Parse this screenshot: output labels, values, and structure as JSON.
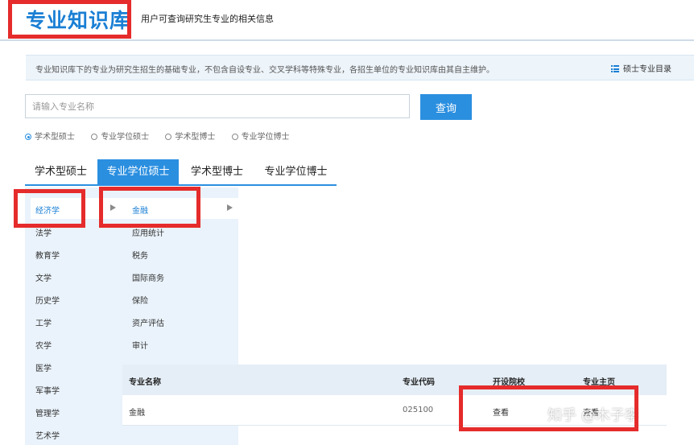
{
  "header": {
    "title": "专业知识库",
    "subtitle": "用户可查询研究生专业的相关信息"
  },
  "notice": {
    "text": "专业知识库下的专业为研究生招生的基础专业，不包含自设专业、交叉学科等特殊专业，各招生单位的专业知识库由其自主维护。",
    "catalog_link": "硕士专业目录"
  },
  "search": {
    "placeholder": "请输入专业名称",
    "value": "",
    "button": "查询"
  },
  "radios": [
    {
      "label": "学术型硕士",
      "checked": true
    },
    {
      "label": "专业学位硕士",
      "checked": false
    },
    {
      "label": "学术型博士",
      "checked": false
    },
    {
      "label": "专业学位博士",
      "checked": false
    }
  ],
  "tabs": [
    {
      "label": "学术型硕士",
      "active": false
    },
    {
      "label": "专业学位硕士",
      "active": true
    },
    {
      "label": "学术型博士",
      "active": false
    },
    {
      "label": "专业学位博士",
      "active": false
    }
  ],
  "categories": [
    "经济学",
    "法学",
    "教育学",
    "文学",
    "历史学",
    "工学",
    "农学",
    "医学",
    "军事学",
    "管理学",
    "艺术学"
  ],
  "subcategories": [
    "金融",
    "应用统计",
    "税务",
    "国际商务",
    "保险",
    "资产评估",
    "审计"
  ],
  "table": {
    "headers": [
      "专业名称",
      "专业代码",
      "开设院校",
      "专业主页"
    ],
    "rows": [
      {
        "name": "金融",
        "code": "025100",
        "schools": "查看",
        "homepage": "查看"
      }
    ]
  },
  "watermark": "知乎 @木子李",
  "colors": {
    "accent": "#2b8fe0",
    "title": "#1a7fd4",
    "highlight_box": "#e52b2b",
    "panel_bg": "#eaf3fb"
  }
}
